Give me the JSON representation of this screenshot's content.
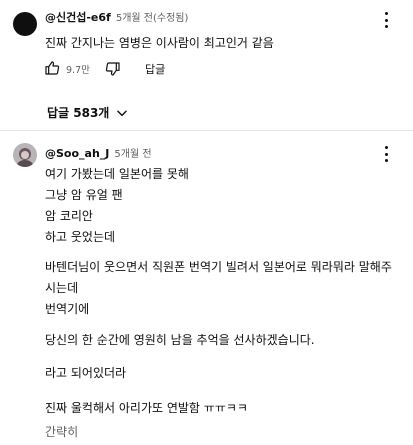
{
  "comment1": {
    "author": "@신건섭-e6f",
    "time": "5개월 전(수정됨)",
    "text": "진짜 간지나는 염병은 이사람이 최고인거 같음",
    "likes": "9.7만",
    "reply_label": "답글",
    "replies_toggle": "답글 583개"
  },
  "comment2": {
    "author": "@Soo_ah_J",
    "time": "5개월 전",
    "lines": [
      "여기 가봤는데 일본어를 못해",
      "그냥 암 유얼 팬",
      "암 코리안",
      "하고 웃었는데",
      "바텐더님이 웃으면서 직원폰 번역기 빌려서 일본어로 뭐라뭐라 말해주",
      "시는데",
      "번역기에",
      "당신의 한 순간에 영원히 남을 추억을 선사하겠습니다.",
      "라고 되어있더라",
      "진짜 울컥해서 아리가또 연발함 ㅠㅠㅋㅋ",
      "간략히"
    ]
  },
  "icons": [
    "like-icon",
    "dislike-icon",
    "more-icon",
    "chevron-down-icon"
  ]
}
